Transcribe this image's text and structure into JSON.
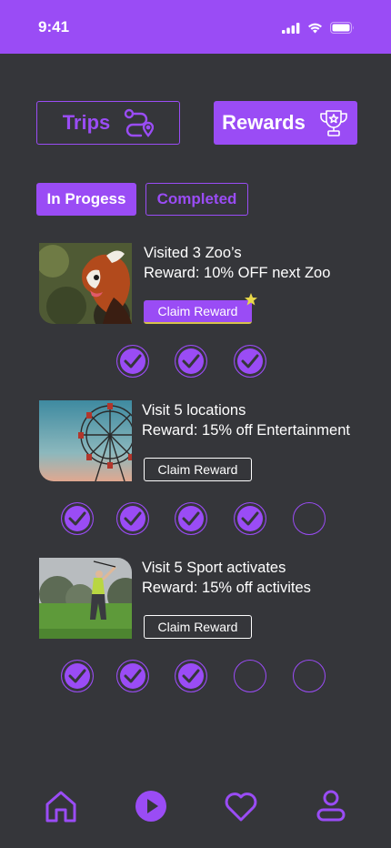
{
  "status": {
    "time": "9:41"
  },
  "top_buttons": {
    "trips": "Trips",
    "rewards": "Rewards"
  },
  "tabs": {
    "in_progress": "In Progess",
    "completed": "Completed"
  },
  "rewards": [
    {
      "title": "Visited 3 Zoo’s",
      "reward": "Reward: 10% OFF next Zoo",
      "claim": "Claim Reward",
      "progress": [
        true,
        true,
        true
      ],
      "claimable": true,
      "image": "red-panda"
    },
    {
      "title": "Visit 5 locations",
      "reward": "Reward: 15% off Entertainment",
      "claim": "Claim Reward",
      "progress": [
        true,
        true,
        true,
        true,
        false
      ],
      "claimable": false,
      "image": "ferris-wheel"
    },
    {
      "title": "Visit 5 Sport activates",
      "reward": "Reward: 15% off activites",
      "claim": "Claim Reward",
      "progress": [
        true,
        true,
        true,
        false,
        false
      ],
      "claimable": false,
      "image": "golfer"
    }
  ],
  "nav": [
    "home-icon",
    "play-icon",
    "heart-icon",
    "profile-icon"
  ],
  "colors": {
    "accent": "#9a4cf5",
    "background": "#35363a"
  }
}
